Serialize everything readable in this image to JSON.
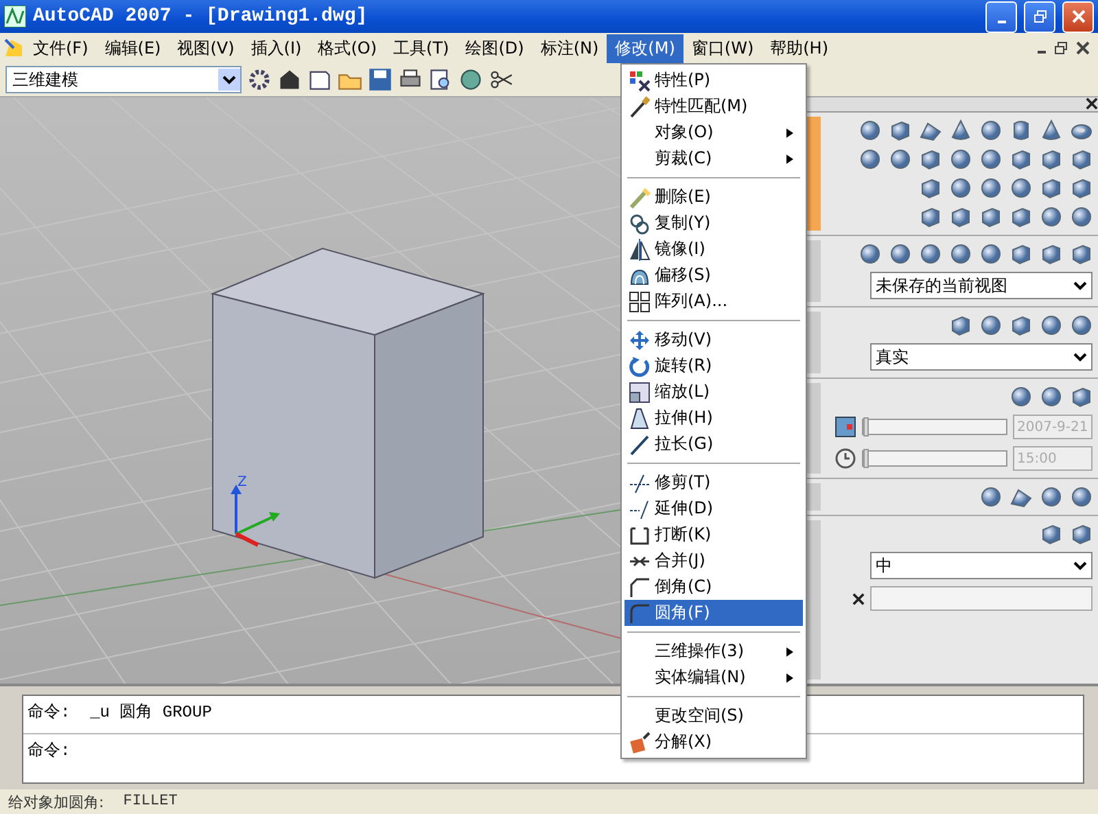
{
  "window": {
    "title": "AutoCAD 2007 - [Drawing1.dwg]"
  },
  "menubar": [
    {
      "label": "文件(F)",
      "selected": false
    },
    {
      "label": "编辑(E)",
      "selected": false
    },
    {
      "label": "视图(V)",
      "selected": false
    },
    {
      "label": "插入(I)",
      "selected": false
    },
    {
      "label": "格式(O)",
      "selected": false
    },
    {
      "label": "工具(T)",
      "selected": false
    },
    {
      "label": "绘图(D)",
      "selected": false
    },
    {
      "label": "标注(N)",
      "selected": false
    },
    {
      "label": "修改(M)",
      "selected": true
    },
    {
      "label": "窗口(W)",
      "selected": false
    },
    {
      "label": "帮助(H)",
      "selected": false
    }
  ],
  "workspace": {
    "value": "三维建模"
  },
  "viewport": {
    "axis_label": "Z"
  },
  "menu": [
    {
      "kind": "item",
      "label": "特性(P)",
      "has_icon": true,
      "submenu": false,
      "selected": false
    },
    {
      "kind": "item",
      "label": "特性匹配(M)",
      "has_icon": true,
      "submenu": false,
      "selected": false
    },
    {
      "kind": "item",
      "label": "对象(O)",
      "has_icon": false,
      "submenu": true,
      "selected": false
    },
    {
      "kind": "item",
      "label": "剪裁(C)",
      "has_icon": false,
      "submenu": true,
      "selected": false
    },
    {
      "kind": "separator"
    },
    {
      "kind": "item",
      "label": "删除(E)",
      "has_icon": true,
      "submenu": false,
      "selected": false
    },
    {
      "kind": "item",
      "label": "复制(Y)",
      "has_icon": true,
      "submenu": false,
      "selected": false
    },
    {
      "kind": "item",
      "label": "镜像(I)",
      "has_icon": true,
      "submenu": false,
      "selected": false
    },
    {
      "kind": "item",
      "label": "偏移(S)",
      "has_icon": true,
      "submenu": false,
      "selected": false
    },
    {
      "kind": "item",
      "label": "阵列(A)...",
      "has_icon": true,
      "submenu": false,
      "selected": false
    },
    {
      "kind": "separator"
    },
    {
      "kind": "item",
      "label": "移动(V)",
      "has_icon": true,
      "submenu": false,
      "selected": false
    },
    {
      "kind": "item",
      "label": "旋转(R)",
      "has_icon": true,
      "submenu": false,
      "selected": false
    },
    {
      "kind": "item",
      "label": "缩放(L)",
      "has_icon": true,
      "submenu": false,
      "selected": false
    },
    {
      "kind": "item",
      "label": "拉伸(H)",
      "has_icon": true,
      "submenu": false,
      "selected": false
    },
    {
      "kind": "item",
      "label": "拉长(G)",
      "has_icon": true,
      "submenu": false,
      "selected": false
    },
    {
      "kind": "separator"
    },
    {
      "kind": "item",
      "label": "修剪(T)",
      "has_icon": true,
      "submenu": false,
      "selected": false
    },
    {
      "kind": "item",
      "label": "延伸(D)",
      "has_icon": true,
      "submenu": false,
      "selected": false
    },
    {
      "kind": "item",
      "label": "打断(K)",
      "has_icon": true,
      "submenu": false,
      "selected": false
    },
    {
      "kind": "item",
      "label": "合并(J)",
      "has_icon": true,
      "submenu": false,
      "selected": false
    },
    {
      "kind": "item",
      "label": "倒角(C)",
      "has_icon": true,
      "submenu": false,
      "selected": false
    },
    {
      "kind": "item",
      "label": "圆角(F)",
      "has_icon": true,
      "submenu": false,
      "selected": true
    },
    {
      "kind": "separator"
    },
    {
      "kind": "item",
      "label": "三维操作(3)",
      "has_icon": false,
      "submenu": true,
      "selected": false
    },
    {
      "kind": "item",
      "label": "实体编辑(N)",
      "has_icon": false,
      "submenu": true,
      "selected": false
    },
    {
      "kind": "separator"
    },
    {
      "kind": "item",
      "label": "更改空间(S)",
      "has_icon": false,
      "submenu": false,
      "selected": false
    },
    {
      "kind": "item",
      "label": "分解(X)",
      "has_icon": true,
      "submenu": false,
      "selected": false
    }
  ],
  "panel": {
    "view_dropdown": "未保存的当前视图",
    "style_dropdown": "真实",
    "date_slider": {
      "level": 0
    },
    "time_slider": {
      "level": 0
    },
    "date_value": "2007-9-21",
    "time_value": "15:00",
    "quality_dropdown": "中"
  },
  "command": {
    "lines": [
      "命令:  _u 圆角 GROUP",
      "命令:"
    ]
  },
  "status_bar": {
    "description": "给对象加圆角:",
    "command": "FILLET"
  }
}
